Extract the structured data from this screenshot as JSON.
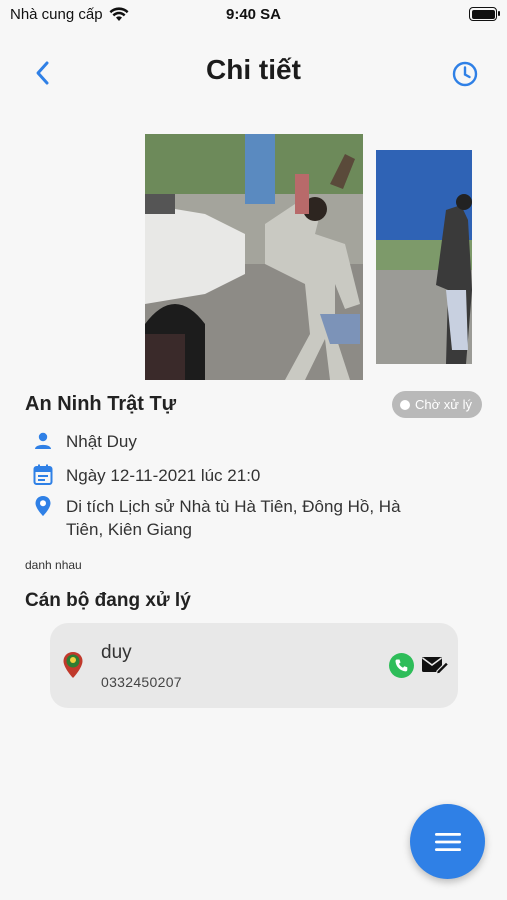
{
  "status_bar": {
    "carrier": "Nhà cung cấp",
    "time": "9:40 SA"
  },
  "header": {
    "title": "Chi tiết",
    "back_icon": "chevron-left-icon",
    "history_icon": "clock-icon"
  },
  "incident": {
    "title": "An Ninh Trật Tự",
    "status": "Chờ xử lý",
    "reporter": "Nhật Duy",
    "datetime": "Ngày 12-11-2021 lúc 21:0",
    "location": "Di tích Lịch sử Nhà tù Hà Tiên, Đông Hồ, Hà Tiên, Kiên Giang",
    "description": "danh nhau"
  },
  "officers": {
    "section_title": "Cán bộ đang xử lý",
    "items": [
      {
        "name": "duy",
        "phone": "0332450207"
      }
    ]
  },
  "colors": {
    "accent": "#2f80e6",
    "call_green": "#2ebd59",
    "badge_gray": "#b9b9b9"
  },
  "fab": {
    "icon": "menu-icon"
  }
}
